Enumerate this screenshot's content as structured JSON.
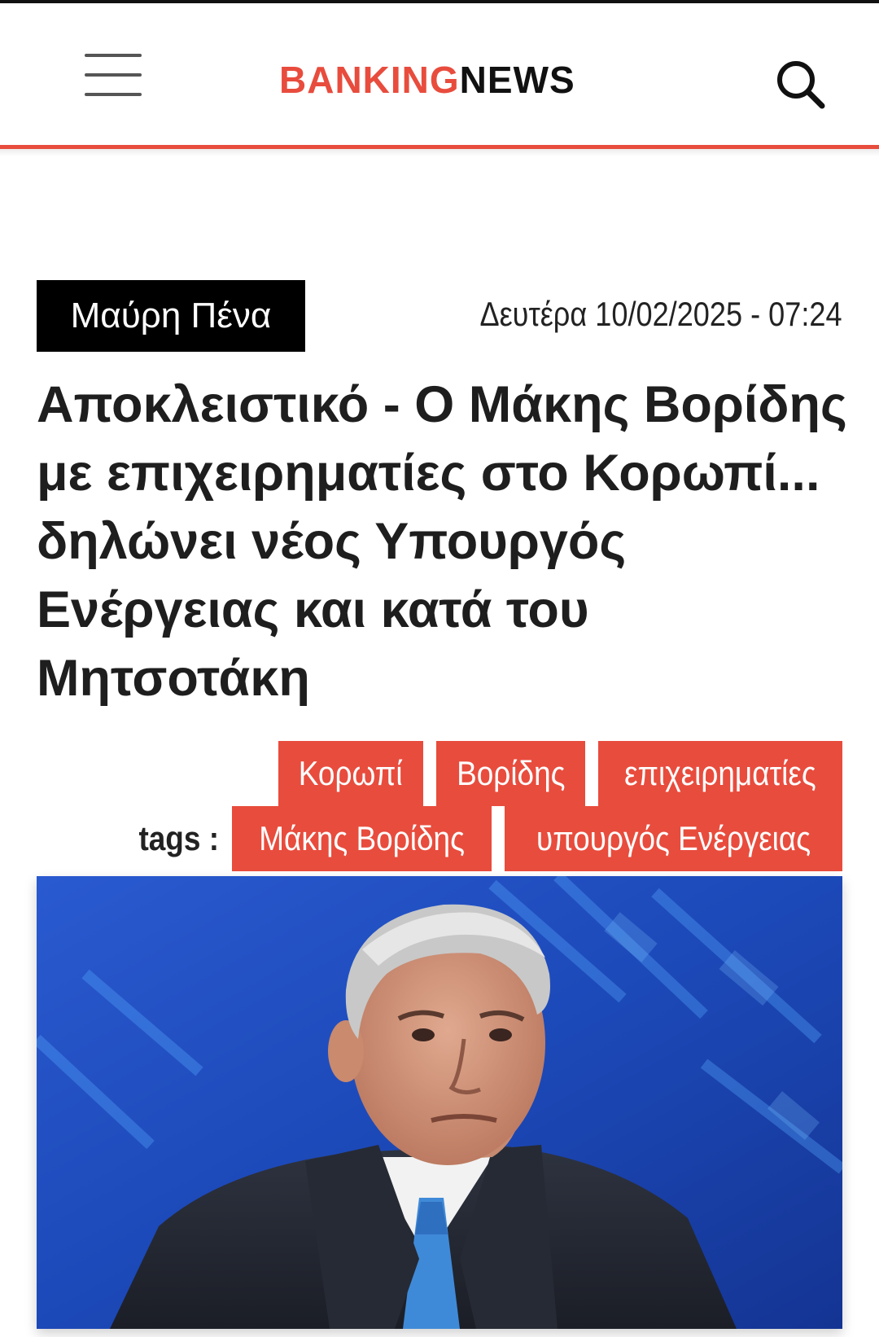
{
  "header": {
    "logo_part1": "BANKING",
    "logo_part2": "NEWS",
    "menu_icon": "hamburger-menu-icon",
    "search_icon": "search-icon",
    "accent_color": "#e84c3d"
  },
  "article": {
    "category": "Μαύρη Πένα",
    "date": "Δευτέρα 10/02/2025 - 07:24",
    "title": "Αποκλειστικό - Ο Μάκης Βορίδης με επιχειρηματίες στο Κορωπί... δηλώνει νέος Υπουργός Ενέργειας και κατά του Μητσοτάκη",
    "tags_label": "tags :",
    "tags_row1": [
      "Κορωπί",
      "Βορίδης",
      "επιχειρηματίες"
    ],
    "tags_row2": [
      "Μάκης Βορίδης",
      "υπουργός Ενέργειας"
    ]
  }
}
